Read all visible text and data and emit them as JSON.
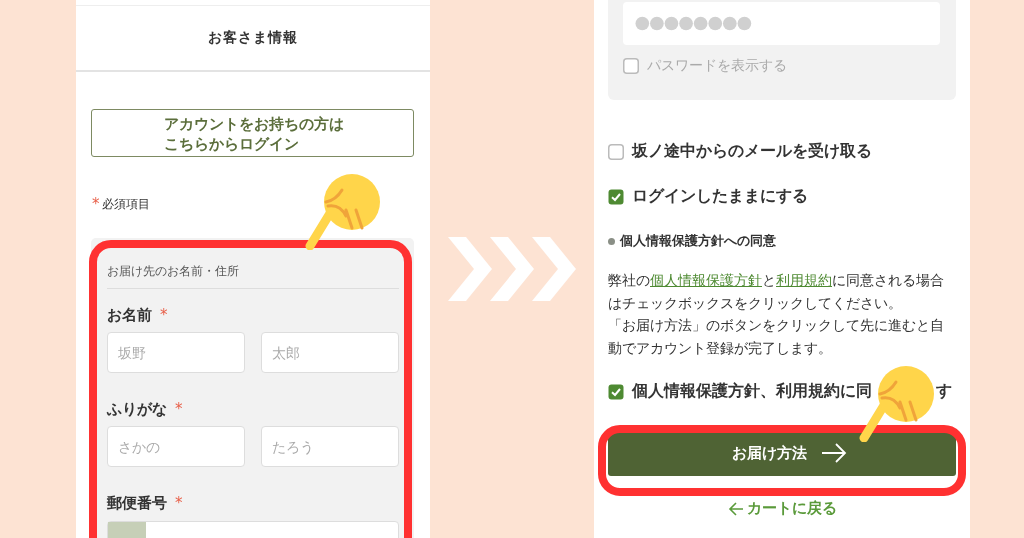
{
  "left_screen": {
    "header": {
      "title": "お客さま情報"
    },
    "login_button": {
      "lines": [
        "アカウントをお持ちの方は",
        "こちらからログイン"
      ]
    },
    "required_note": {
      "mark": "*",
      "label": "必須項目"
    },
    "form_section": {
      "title": "お届け先のお名前・住所",
      "fields": [
        {
          "kind": "pair",
          "label": "お名前",
          "mark": "*",
          "inputs": [
            {
              "placeholder": "坂野"
            },
            {
              "placeholder": "太郎"
            }
          ]
        },
        {
          "kind": "pair",
          "label": "ふりがな",
          "mark": "*",
          "inputs": [
            {
              "placeholder": "さかの"
            },
            {
              "placeholder": "たろう"
            }
          ]
        },
        {
          "kind": "postal",
          "label": "郵便番号",
          "mark": "*"
        }
      ]
    }
  },
  "right_screen": {
    "password": {
      "kind": "masked",
      "show_password": {
        "label": "パスワードを表示する",
        "checked": false
      }
    },
    "options": [
      {
        "label": "坂ノ途中からのメールを受け取る",
        "checked": false
      },
      {
        "label": "ログインしたままにする",
        "checked": true
      }
    ],
    "consent": {
      "heading": "個人情報保護方針への同意",
      "text_parts": [
        {
          "text": "弊社の"
        },
        {
          "text": "個人情報保護方針",
          "link": true
        },
        {
          "text": "と"
        },
        {
          "text": "利用規約",
          "link": true
        },
        {
          "text": "に同意される場合はチェックボックスをクリックしてください。"
        }
      ],
      "note": "「お届け方法」のボタンをクリックして先に進むと自動でアカウント登録が完了します。"
    },
    "agree": {
      "label_parts": [
        "個人情報保護方針、利用規約に同",
        "す"
      ],
      "checked": true
    },
    "next_button": {
      "label": "お届け方法"
    },
    "back_link": {
      "label": "カートに戻る"
    }
  }
}
